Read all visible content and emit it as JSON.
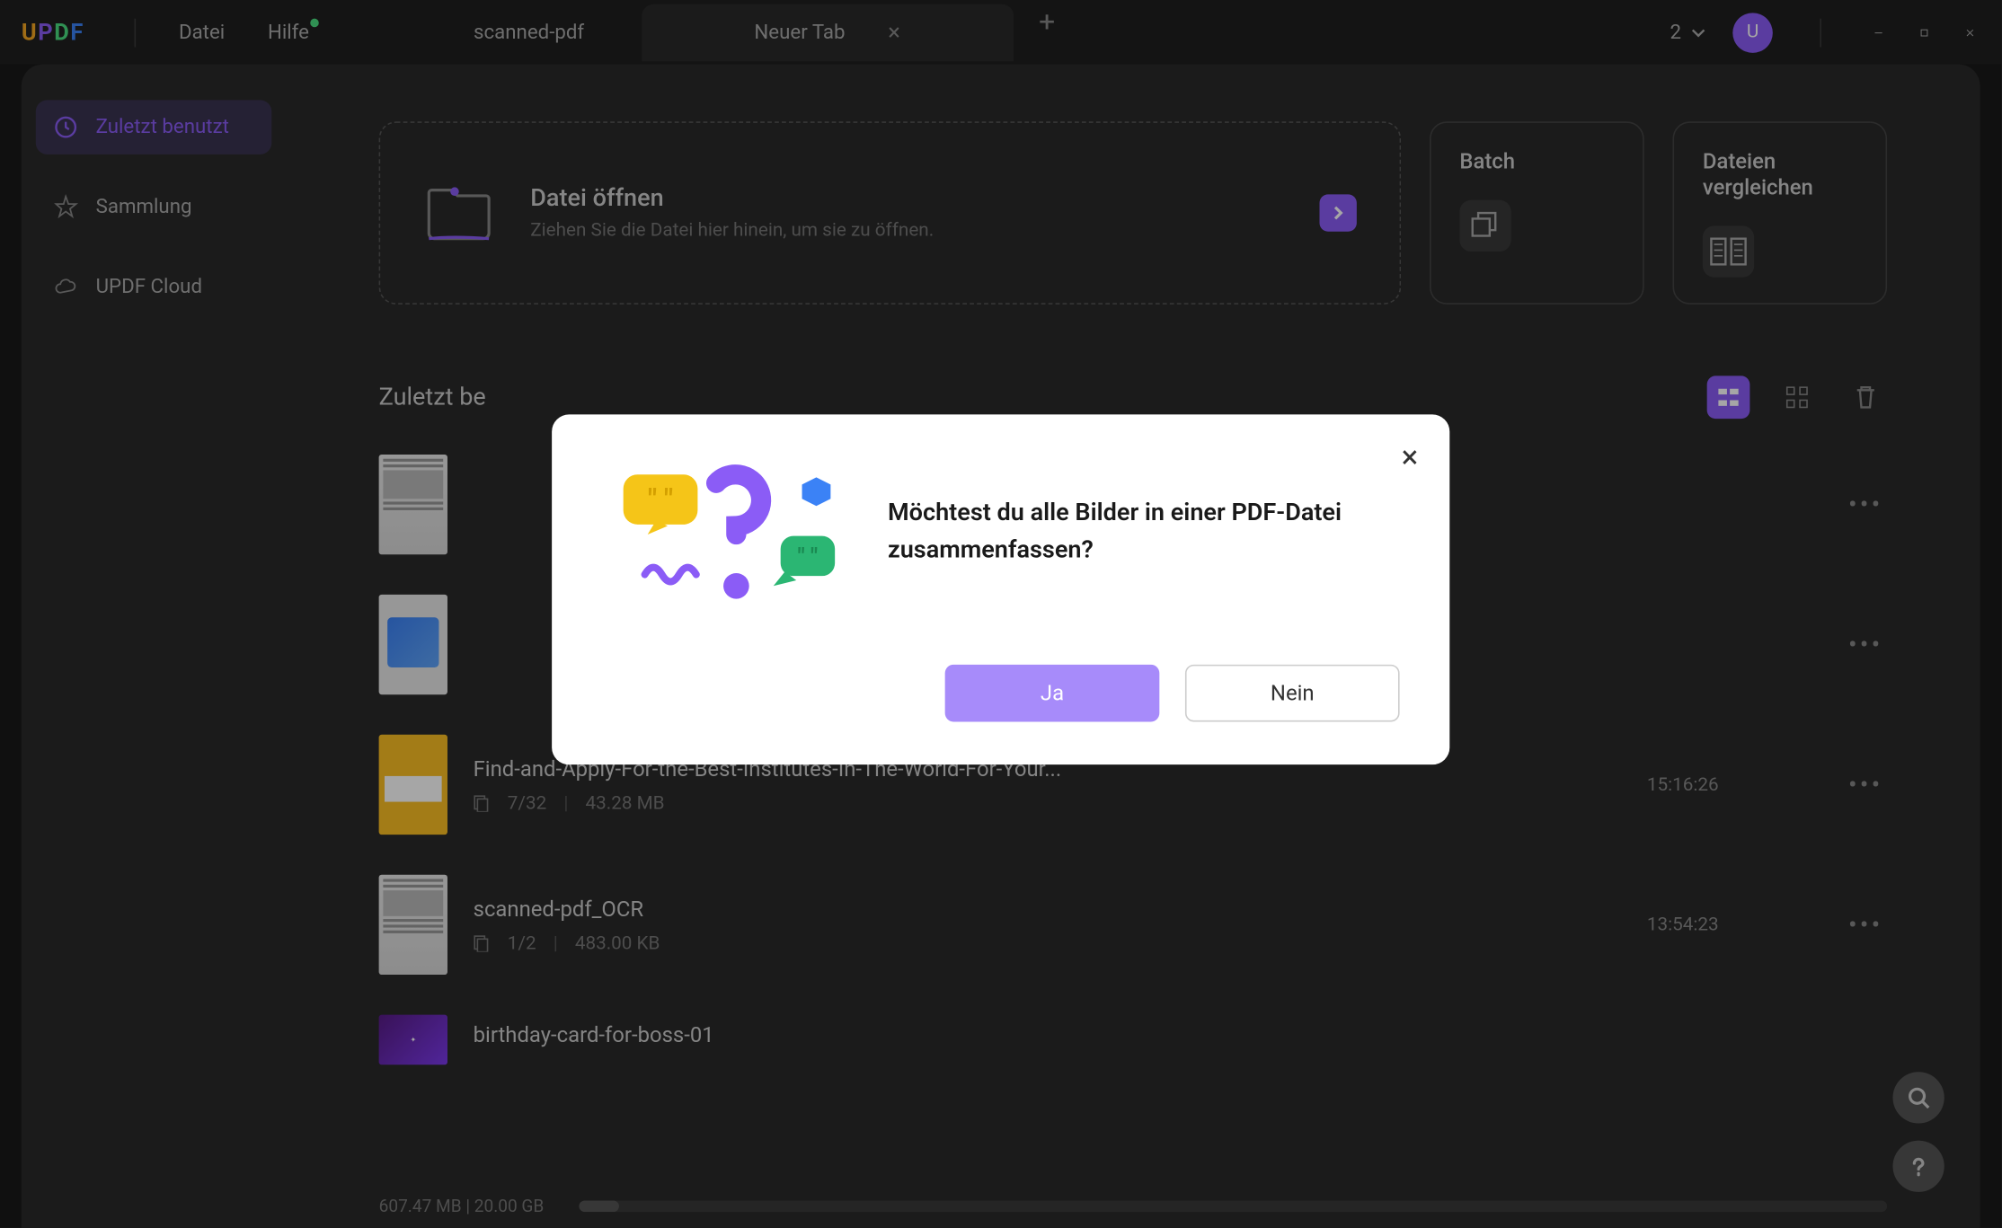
{
  "titlebar": {
    "menus": {
      "file": "Datei",
      "help": "Hilfe"
    },
    "tabs": {
      "inactive": "scanned-pdf",
      "active": "Neuer Tab"
    },
    "notif_count": "2",
    "avatar_letter": "U"
  },
  "sidebar": {
    "recent": "Zuletzt benutzt",
    "collection": "Sammlung",
    "cloud": "UPDF Cloud"
  },
  "open_card": {
    "title": "Datei öffnen",
    "subtitle": "Ziehen Sie die Datei hier hinein, um sie zu öffnen."
  },
  "action_cards": {
    "batch": "Batch",
    "compare": "Dateien vergleichen"
  },
  "recent": {
    "title": "Zuletzt be",
    "files": [
      {
        "name": "",
        "pages": "",
        "size": "",
        "time": ""
      },
      {
        "name": "",
        "pages": "",
        "size": "",
        "time": ""
      },
      {
        "name": "Find-and-Apply-For-the-Best-Institutes-In-The-World-For-Your...",
        "pages": "7/32",
        "size": "43.28 MB",
        "time": "15:16:26"
      },
      {
        "name": "scanned-pdf_OCR",
        "pages": "1/2",
        "size": "483.00 KB",
        "time": "13:54:23"
      },
      {
        "name": "birthday-card-for-boss-01",
        "pages": "",
        "size": "",
        "time": ""
      }
    ]
  },
  "storage": {
    "text": "607.47 MB | 20.00 GB"
  },
  "modal": {
    "text": "Möchtest du alle Bilder in einer PDF-Datei zusammenfassen?",
    "yes": "Ja",
    "no": "Nein"
  }
}
